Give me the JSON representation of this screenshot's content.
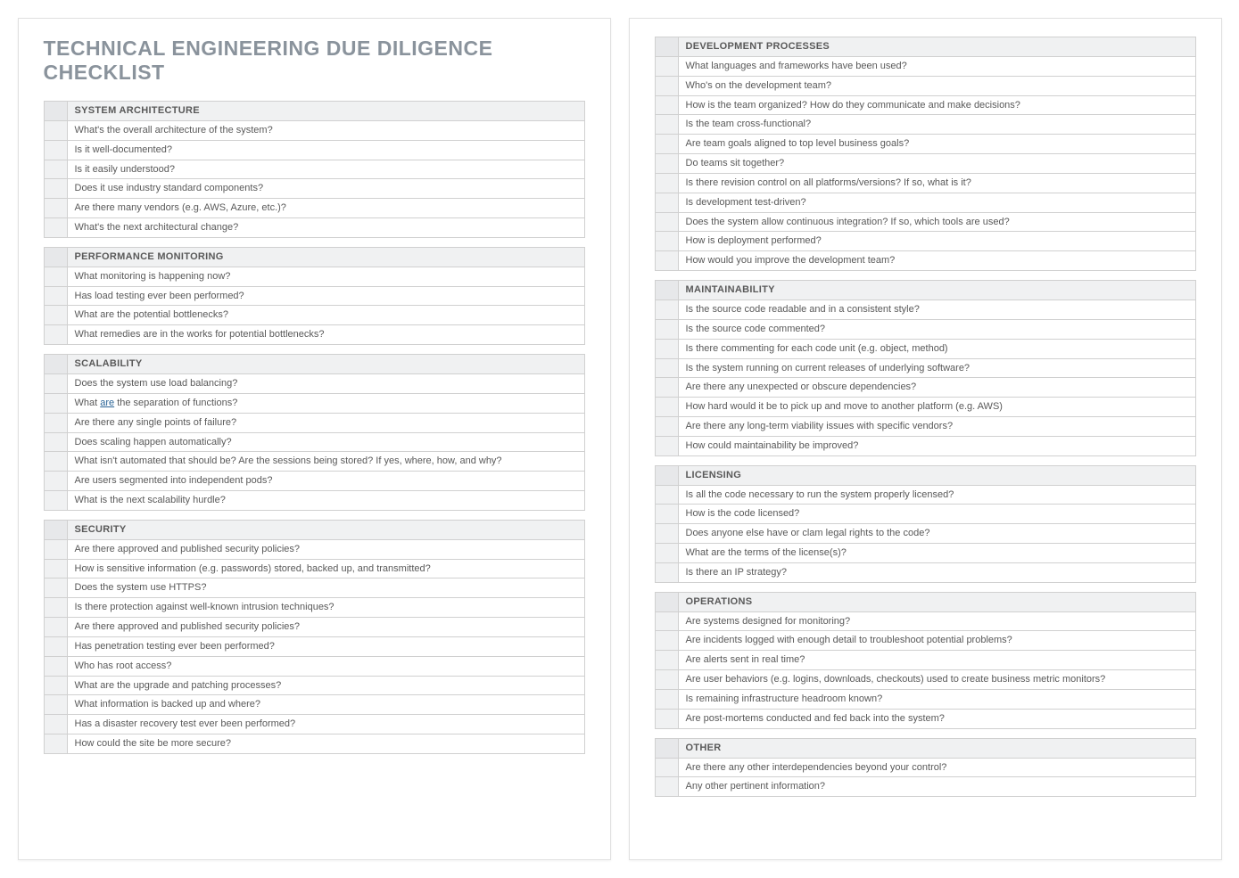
{
  "title": "TECHNICAL ENGINEERING DUE DILIGENCE CHECKLIST",
  "pages": [
    {
      "sections": [
        {
          "header": "SYSTEM ARCHITECTURE",
          "items": [
            "What's the overall architecture of the system?",
            "Is it well-documented?",
            "Is it easily understood?",
            "Does it use industry standard components?",
            "Are there many vendors (e.g. AWS, Azure, etc.)?",
            "What's the next architectural change?"
          ]
        },
        {
          "header": "PERFORMANCE MONITORING",
          "items": [
            "What monitoring is happening now?",
            "Has load testing ever been performed?",
            "What are the potential bottlenecks?",
            "What remedies are in the works for potential bottlenecks?"
          ]
        },
        {
          "header": "SCALABILITY",
          "items": [
            "Does the system use load balancing?",
            "What <u>are</u> the separation of functions?",
            "Are there any single points of failure?",
            "Does scaling happen automatically?",
            "What isn't automated that should be? Are the sessions being stored? If yes, where, how, and why?",
            "Are users segmented into independent pods?",
            "What is the next scalability hurdle?"
          ]
        },
        {
          "header": "SECURITY",
          "items": [
            "Are there approved and published security policies?",
            "How is sensitive information (e.g. passwords) stored, backed up, and transmitted?",
            "Does the system use HTTPS?",
            "Is there protection against well-known intrusion techniques?",
            "Are there approved and published security policies?",
            "Has penetration testing ever been performed?",
            "Who has root access?",
            "What are the upgrade and patching processes?",
            "What information is backed up and where?",
            "Has a disaster recovery test ever been performed?",
            "How could the site be more secure?"
          ]
        }
      ]
    },
    {
      "sections": [
        {
          "header": "DEVELOPMENT PROCESSES",
          "items": [
            "What languages and frameworks have been used?",
            "Who's on the development team?",
            "How is the team organized? How do they communicate and make decisions?",
            "Is the team cross-functional?",
            "Are team goals aligned to top level business goals?",
            "Do teams sit together?",
            "Is there revision control on all platforms/versions? If so, what is it?",
            "Is development test-driven?",
            "Does the system allow continuous integration? If so, which tools are used?",
            "How is deployment performed?",
            "How would you improve the development team?"
          ]
        },
        {
          "header": "MAINTAINABILITY",
          "items": [
            "Is the source code readable and in a consistent style?",
            "Is the source code commented?",
            "Is there commenting for each code unit (e.g. object, method)",
            "Is the system running on current releases of underlying software?",
            "Are there any unexpected or obscure dependencies?",
            "How hard would it be to pick up and move to another platform (e.g. AWS)",
            "Are there any long-term viability issues with specific vendors?",
            "How could maintainability be improved?"
          ]
        },
        {
          "header": "LICENSING",
          "items": [
            "Is all the code necessary to run the system properly licensed?",
            "How is the code licensed?",
            "Does anyone else have or clam legal rights to the code?",
            "What are the terms of the license(s)?",
            "Is there an IP strategy?"
          ]
        },
        {
          "header": "OPERATIONS",
          "items": [
            "Are systems designed for monitoring?",
            "Are incidents logged with enough detail to troubleshoot potential problems?",
            "Are alerts sent in real time?",
            "Are user behaviors (e.g. logins, downloads, checkouts) used to create business metric monitors?",
            "Is remaining infrastructure headroom known?",
            "Are post-mortems conducted and fed back into the system?"
          ]
        },
        {
          "header": "OTHER",
          "items": [
            "Are there any other interdependencies beyond your control?",
            "Any other pertinent information?"
          ]
        }
      ]
    }
  ]
}
